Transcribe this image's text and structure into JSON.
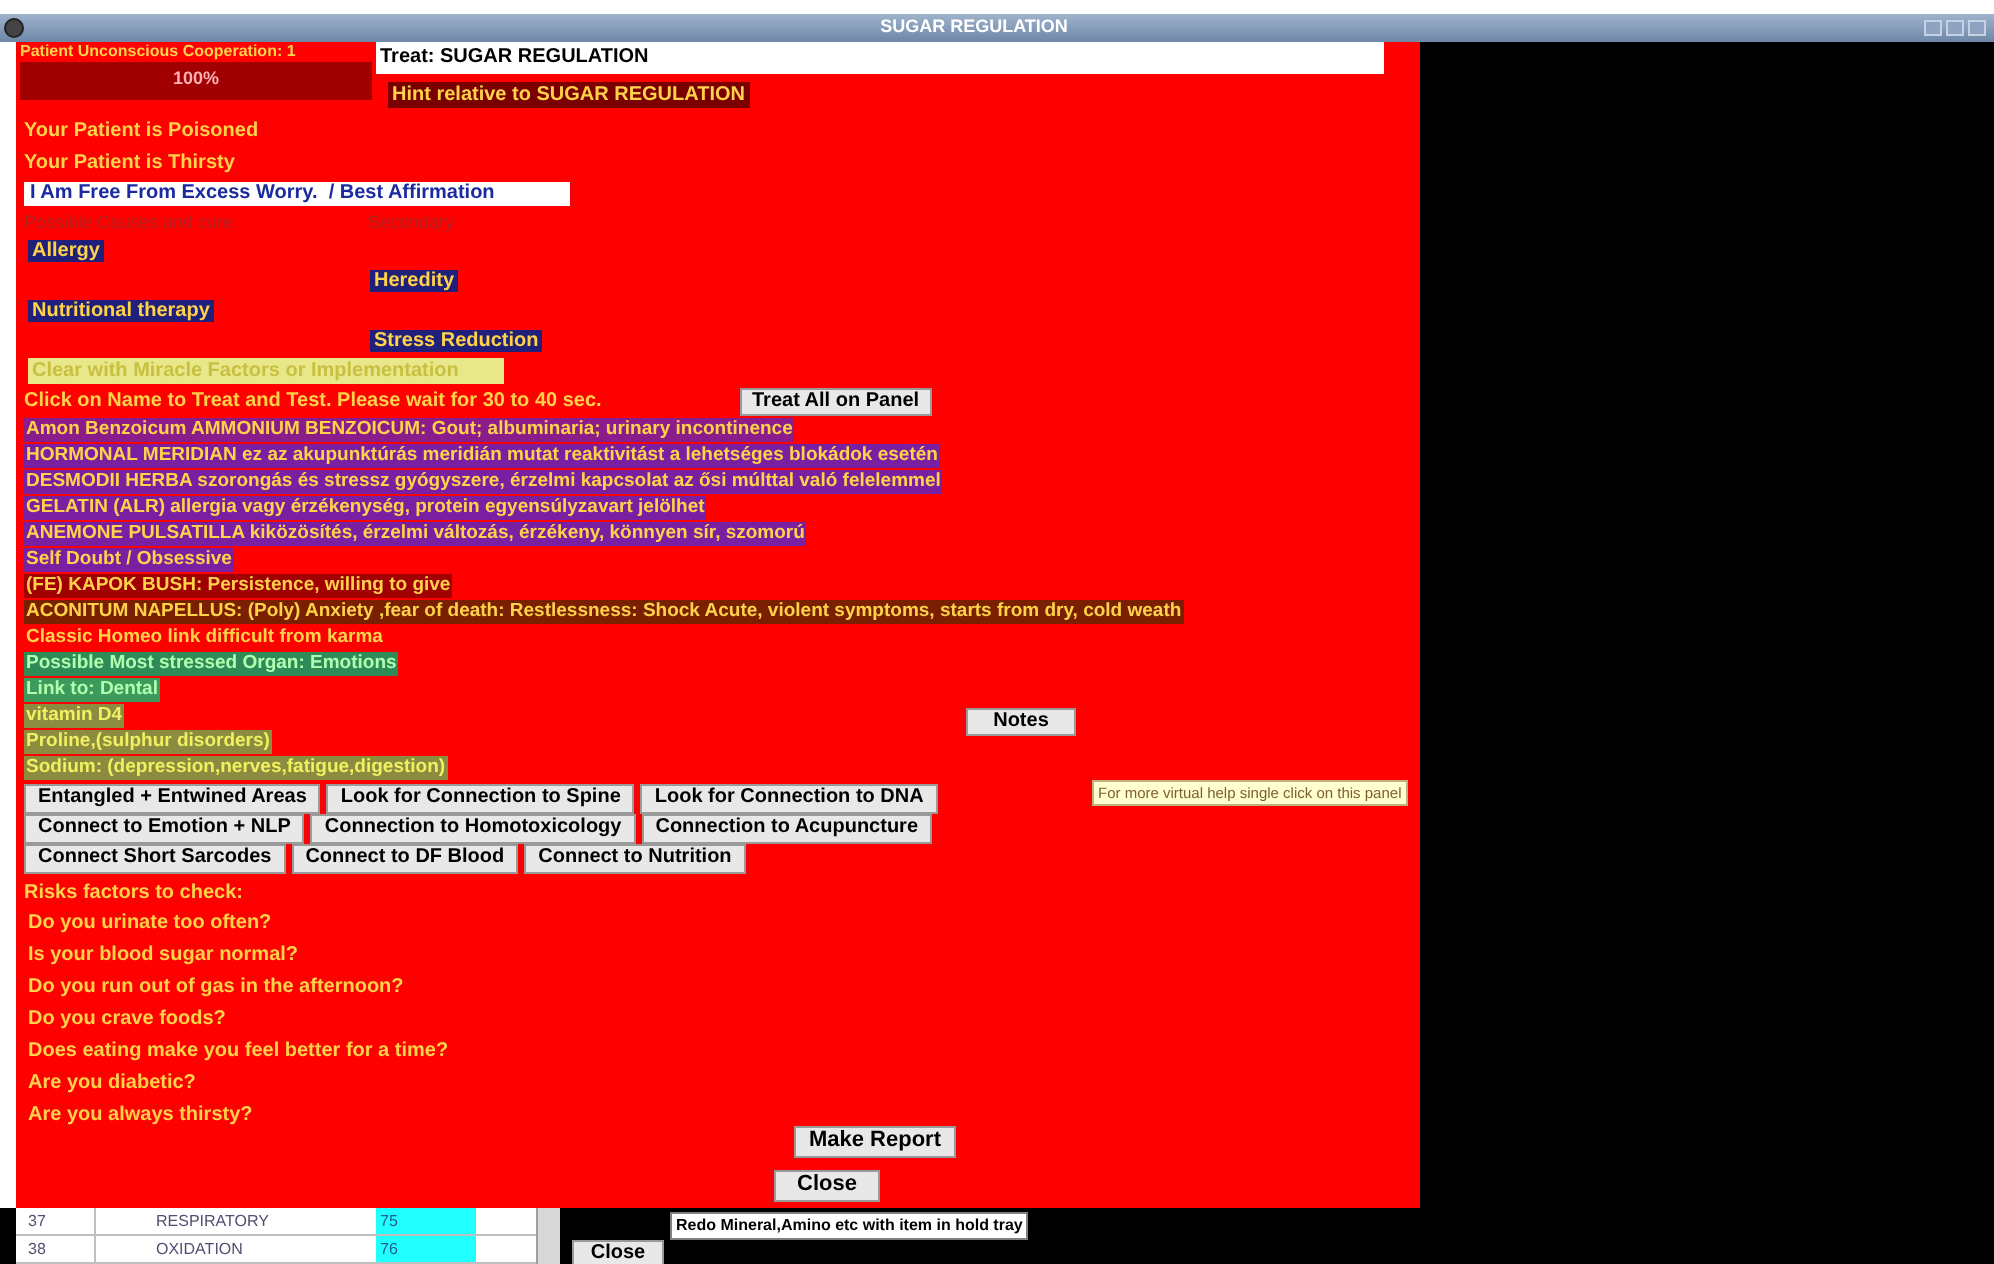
{
  "window": {
    "title": "SUGAR REGULATION"
  },
  "cooperation": {
    "label": "Patient Unconscious Cooperation: 1",
    "reading": "100%",
    "level": 1
  },
  "treat_field": {
    "value": "Treat: SUGAR REGULATION"
  },
  "hint": "Hint relative to SUGAR REGULATION",
  "alerts": [
    "Your Patient is Poisoned",
    "Your Patient is Thirsty"
  ],
  "affirmation": "I Am Free From Excess Worry.  / Best Affirmation",
  "causes_header": [
    "Possible Causes and cure",
    "Secondary"
  ],
  "causes": [
    {
      "label": "Allergy",
      "kind": "primary"
    },
    {
      "label": "Heredity",
      "kind": "secondary"
    },
    {
      "label": "Nutritional therapy",
      "kind": "primary"
    },
    {
      "label": "Stress Reduction",
      "kind": "secondary"
    }
  ],
  "banner": "Clear with Miracle Factors or Implementation",
  "instruction": "Click on Name to Treat and Test. Please wait for 30 to 40 sec.",
  "treat_all_button": "Treat All on Panel",
  "remedies": [
    {
      "text": "Amon Benzoicum  AMMONIUM BENZOICUM: Gout; albuminaria; urinary incontinence",
      "kind": "remedy",
      "color": "#8a1c8c"
    },
    {
      "text": "HORMONAL MERIDIAN ez az akupunktúrás meridián mutat reaktivitást a lehetséges blokádok esetén",
      "kind": "remedy",
      "color": "#7b1fa2"
    },
    {
      "text": "DESMODII HERBA  szorongás és stressz gyógyszere,  érzelmi kapcsolat az ősi múlttal való felelemmel",
      "kind": "remedy",
      "color": "#7b1fa2"
    },
    {
      "text": "GELATIN (ALR)   allergia vagy érzékenység, protein egyensúlyzavart jelölhet",
      "kind": "remedy",
      "color": "#7b1fa2"
    },
    {
      "text": "ANEMONE PULSATILLA kiközösítés,   érzelmi változás, érzékeny, könnyen sír, szomorú",
      "kind": "remedy",
      "color": "#7b1fa2"
    },
    {
      "text": "Self Doubt / Obsessive",
      "kind": "remedy",
      "color": "#7b1fa2"
    },
    {
      "text": "(FE) KAPOK BUSH: Persistence, willing to give",
      "kind": "remedy",
      "color": "#a00000"
    },
    {
      "text": "ACONITUM NAPELLUS: (Poly) Anxiety ,fear of death: Restlessness: Shock Acute, violent symptoms, starts from dry, cold weath",
      "kind": "remedy",
      "color": "#7a2000"
    },
    {
      "text": "Classic Homeo link difficult from karma",
      "kind": "remedy",
      "color": "#ff0000"
    },
    {
      "text": "Possible Most stressed Organ: Emotions",
      "kind": "organ",
      "color": "#2e8b57"
    },
    {
      "text": "Link to: Dental",
      "kind": "organ",
      "color": "#3c9a5a"
    },
    {
      "text": "vitamin D4",
      "kind": "supplement",
      "color": "#8c8c40"
    },
    {
      "text": "Proline,(sulphur disorders)",
      "kind": "supplement",
      "color": "#8c8c40"
    },
    {
      "text": "Sodium: (depression,nerves,fatigue,digestion)",
      "kind": "supplement",
      "color": "#8c8c40"
    }
  ],
  "notes_button": "Notes",
  "tooltip": "For more virtual help single click on this panel",
  "connection_buttons": [
    [
      "Entangled + Entwined Areas",
      "Look for Connection to Spine",
      "Look for Connection to DNA"
    ],
    [
      "Connect to Emotion + NLP",
      "Connection to Homotoxicology",
      "Connection to Acupuncture"
    ],
    [
      "Connect Short Sarcodes",
      "Connect to DF Blood",
      "Connect to Nutrition"
    ]
  ],
  "risk_title": "Risks factors to check:",
  "risk_questions": [
    "Do you urinate too often?",
    "Is your blood sugar normal?",
    "Do you run out of gas in the afternoon?",
    "Do you crave foods?",
    "Does eating make you feel better for a time?",
    "Are you diabetic?",
    "Are you always thirsty?"
  ],
  "make_report_button": "Make Report",
  "close_button": "Close",
  "table": {
    "rows": [
      {
        "number": "37",
        "name": "RESPIRATORY",
        "value": "75"
      },
      {
        "number": "38",
        "name": "OXIDATION",
        "value": "76"
      }
    ]
  },
  "hold_tray_label": "Redo Mineral,Amino etc with item in hold tray",
  "bottom_close_button": "Close"
}
